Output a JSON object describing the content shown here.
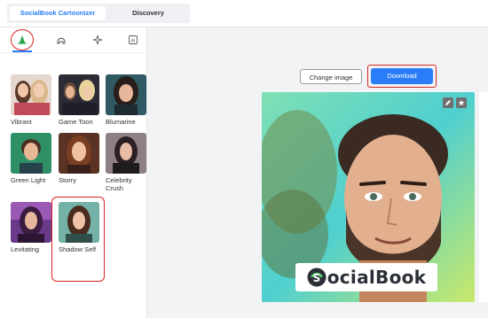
{
  "header": {
    "tabs": [
      {
        "label": "SocialBook Cartoonizer",
        "active": true
      },
      {
        "label": "Discovery",
        "active": false
      }
    ]
  },
  "toolbar": {
    "tools": [
      {
        "icon": "wizard-hat-icon",
        "active": true
      },
      {
        "icon": "helmet-icon",
        "active": false
      },
      {
        "icon": "magic-sparkle-icon",
        "active": false
      },
      {
        "icon": "ai-chip-icon",
        "active": false
      }
    ]
  },
  "styles": [
    {
      "label": "Vibrant",
      "selected": false
    },
    {
      "label": "Game Toon",
      "selected": false
    },
    {
      "label": "Blumarine",
      "selected": false
    },
    {
      "label": "Green Light",
      "selected": false
    },
    {
      "label": "Storry",
      "selected": false
    },
    {
      "label": "Celebrity Crush",
      "selected": false
    },
    {
      "label": "Levitating",
      "selected": false
    },
    {
      "label": "Shadow Self",
      "selected": true
    }
  ],
  "actions": {
    "change_label": "Change image",
    "download_label": "Download"
  },
  "preview": {
    "watermark_text": "ocialBook",
    "watermark_initial": "S"
  },
  "colors": {
    "accent": "#2a7df6",
    "highlight": "#d92323"
  }
}
